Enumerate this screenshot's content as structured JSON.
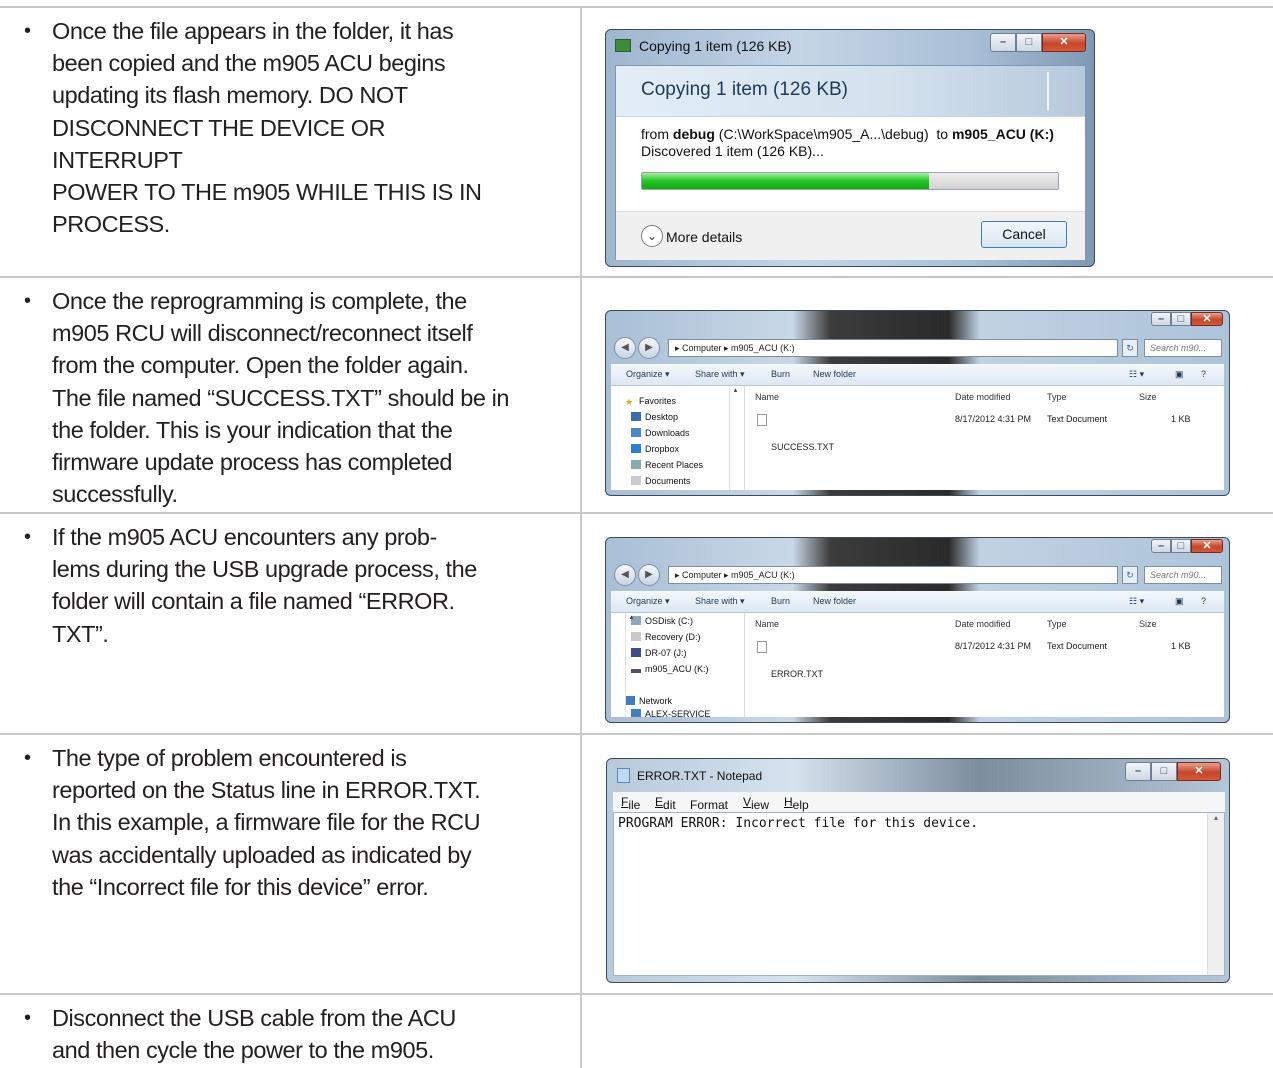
{
  "steps": [
    {
      "bullet": "•",
      "text": "Once the file appears in the folder, it has\nbeen copied and the m905 ACU begins\nupdating its flash memory.  DO NOT\nDISCONNECT THE DEVICE OR INTERRUPT\nPOWER TO THE m905 WHILE THIS IS IN\nPROCESS."
    },
    {
      "bullet": "•",
      "text": "Once the reprogramming is complete, the\nm905 RCU will disconnect/reconnect itself\nfrom the computer.  Open the folder again.\nThe file named “SUCCESS.TXT” should be in\nthe folder.  This is your indication that the\nfirmware update process has completed\nsuccessfully."
    },
    {
      "bullet": "•",
      "text": "If the m905 ACU encounters any prob-\nlems during the USB upgrade process, the\nfolder will contain a file named “ERROR.\nTXT”."
    },
    {
      "bullet": "•",
      "text": "The type of problem encountered is\nreported on the Status line in ERROR.TXT.\nIn this example, a firmware file for the RCU\nwas accidentally uploaded as indicated by\nthe “Incorrect file for this device” error."
    },
    {
      "bullet": "•",
      "text": "Disconnect the USB cable from the ACU\nand then cycle the power to the m905."
    }
  ],
  "copy_dialog": {
    "title": "Copying 1 item (126 KB)",
    "heading": "Copying 1 item (126 KB)",
    "from_label": "from",
    "from_name": "debug",
    "from_path": "(C:\\WorkSpace\\m905_A...\\debug)",
    "to_label": "to",
    "to_name": "m905_ACU (K:)",
    "discovered": "Discovered 1 item (126 KB)...",
    "progress": 0.69,
    "more_details": "More details",
    "cancel": "Cancel",
    "chevron_icon": "chevron-down-icon"
  },
  "explorer": {
    "breadcrumb": "▸ Computer ▸ m905_ACU (K:)",
    "search_placeholder": "Search m90...",
    "toolbar": {
      "organize": "Organize ▾",
      "share": "Share with ▾",
      "burn": "Burn",
      "new_folder": "New folder"
    },
    "columns": {
      "name": "Name",
      "date": "Date modified",
      "type": "Type",
      "size": "Size"
    }
  },
  "explorer1": {
    "nav": [
      "Favorites",
      "Desktop",
      "Downloads",
      "Dropbox",
      "Recent Places",
      "Documents"
    ],
    "file": {
      "name": "SUCCESS.TXT",
      "date": "8/17/2012 4:31 PM",
      "type": "Text Document",
      "size": "1 KB"
    }
  },
  "explorer2": {
    "nav": [
      "OSDisk (C:)",
      "Recovery (D:)",
      "DR-07 (J:)",
      "m905_ACU (K:)",
      "Network",
      "ALEX-SERVICE"
    ],
    "file": {
      "name": "ERROR.TXT",
      "date": "8/17/2012 4:31 PM",
      "type": "Text Document",
      "size": "1 KB"
    }
  },
  "notepad": {
    "title": "ERROR.TXT - Notepad",
    "menu": [
      "File",
      "Edit",
      "Format",
      "View",
      "Help"
    ],
    "content": "PROGRAM ERROR: Incorrect file for this device."
  },
  "colors": {
    "grid": "#c8c8c8",
    "progress": "#25c525",
    "close": "#c7462b"
  }
}
